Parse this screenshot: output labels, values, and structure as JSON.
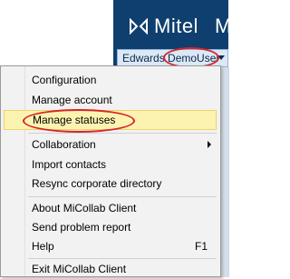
{
  "header": {
    "logo_text": "Mitel",
    "logo_extra": "M",
    "user_name": "Edwards DemoUser",
    "bg_color": "#0f3f6e",
    "highlight_color": "#d6242a"
  },
  "menu": {
    "items": [
      {
        "label": "Configuration"
      },
      {
        "label": "Manage account"
      },
      {
        "label": "Manage statuses"
      },
      {
        "label": "Collaboration"
      },
      {
        "label": "Import contacts"
      },
      {
        "label": "Resync corporate directory"
      },
      {
        "label": "About MiCollab Client"
      },
      {
        "label": "Send problem report"
      },
      {
        "label": "Help",
        "shortcut": "F1"
      },
      {
        "label": "Exit MiCollab Client"
      }
    ]
  }
}
